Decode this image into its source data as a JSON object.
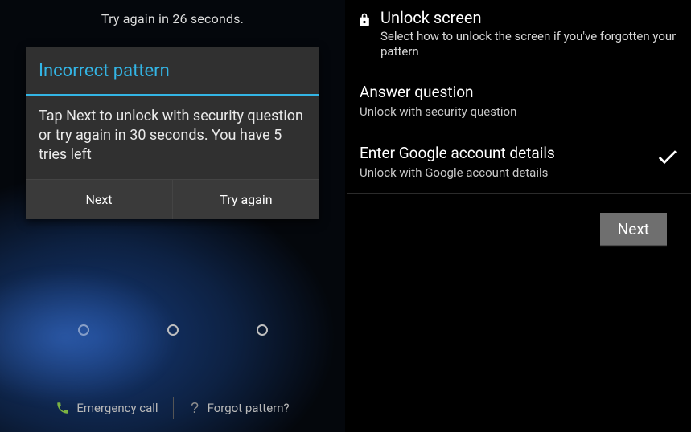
{
  "left": {
    "status": "Try again in 26 seconds.",
    "dialog": {
      "title": "Incorrect pattern",
      "body": "Tap Next to unlock with security question or try again in 30 seconds. You have 5 tries left",
      "next": "Next",
      "try_again": "Try again"
    },
    "emergency": "Emergency call",
    "forgot": "Forgot pattern?"
  },
  "right": {
    "title": "Unlock screen",
    "subtitle": "Select how to unlock the screen if you've forgotten your pattern",
    "options": [
      {
        "title": "Answer question",
        "sub": "Unlock with security question",
        "selected": false
      },
      {
        "title": "Enter Google account details",
        "sub": "Unlock with Google account details",
        "selected": true
      }
    ],
    "next": "Next"
  },
  "colors": {
    "accent": "#33b5e5"
  }
}
